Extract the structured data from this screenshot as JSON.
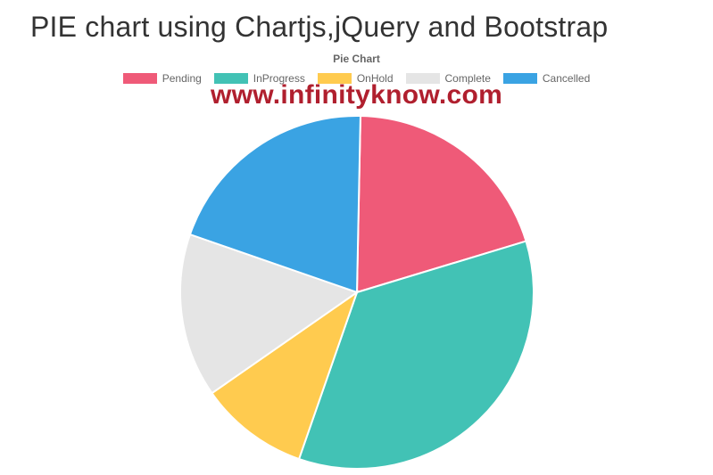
{
  "header": {
    "title": "PIE chart using Chartjs,jQuery and Bootstrap"
  },
  "chart_subtitle": "Pie Chart",
  "watermark": "www.infinityknow.com",
  "legend": {
    "items": [
      {
        "label": "Pending",
        "color": "#ef5a78"
      },
      {
        "label": "InProgress",
        "color": "#42c2b5"
      },
      {
        "label": "OnHold",
        "color": "#ffcb4f"
      },
      {
        "label": "Complete",
        "color": "#e5e5e5"
      },
      {
        "label": "Cancelled",
        "color": "#3aa3e3"
      }
    ]
  },
  "chart_data": {
    "type": "pie",
    "title": "Pie Chart",
    "categories": [
      "Pending",
      "InProgress",
      "OnHold",
      "Complete",
      "Cancelled"
    ],
    "values": [
      20,
      35,
      10,
      15,
      20
    ],
    "series": [
      {
        "name": "Pending",
        "value": 20,
        "color": "#ef5a78"
      },
      {
        "name": "InProgress",
        "value": 35,
        "color": "#42c2b5"
      },
      {
        "name": "OnHold",
        "value": 10,
        "color": "#ffcb4f"
      },
      {
        "name": "Complete",
        "value": 15,
        "color": "#e5e5e5"
      },
      {
        "name": "Cancelled",
        "value": 20,
        "color": "#3aa3e3"
      }
    ]
  }
}
